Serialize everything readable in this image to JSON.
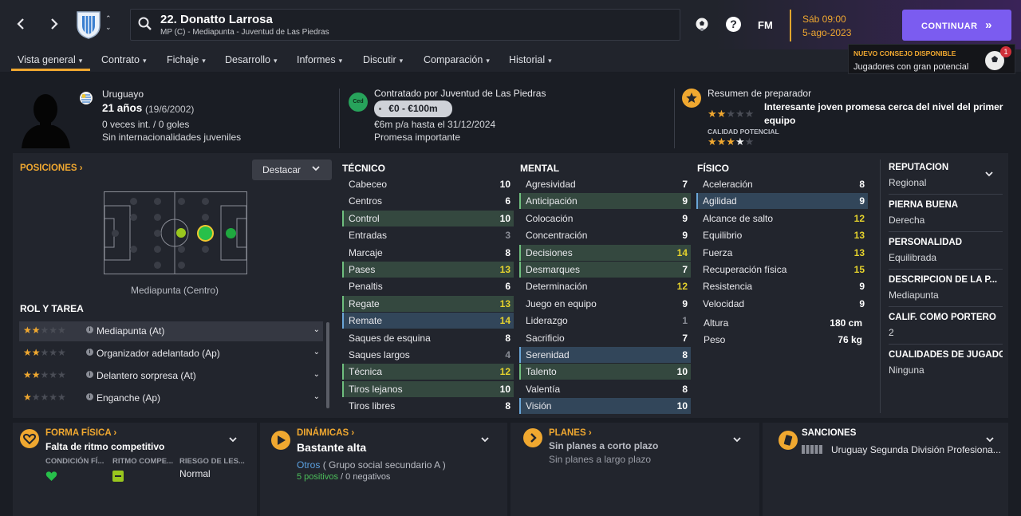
{
  "header": {
    "back_icon": "chevron-left-icon",
    "forward_icon": "chevron-right-icon",
    "player_title": "22. Donatto Larrosa",
    "player_subtitle": "MP (C) - Mediapunta - Juventud de Las Piedras",
    "date_day": "Sáb 09:00",
    "date_full": "5-ago-2023",
    "fm_label": "FM",
    "help_label": "?",
    "continue_label": "CONTINUAR",
    "continue_arrows": "»"
  },
  "advice": {
    "title": "NUEVO CONSEJO DISPONIBLE",
    "text": "Jugadores con gran potencial",
    "count": "1"
  },
  "tabs": [
    {
      "label": "Vista general"
    },
    {
      "label": "Contrato"
    },
    {
      "label": "Fichaje"
    },
    {
      "label": "Desarrollo"
    },
    {
      "label": "Informes"
    },
    {
      "label": "Discutir"
    },
    {
      "label": "Comparación"
    },
    {
      "label": "Historial"
    }
  ],
  "profile": {
    "nationality": "Uruguayo",
    "age": "21 años",
    "birth": "(19/6/2002)",
    "caps": "0 veces int. / 0 goles",
    "youth": "Sin internacionalidades juveniles"
  },
  "contract": {
    "badge": "Ced",
    "contracted_by": "Contratado por Juventud de Las Piedras",
    "value": "€0 - €100m",
    "wage": "€6m p/a hasta el 31/12/2024",
    "status": "Promesa importante"
  },
  "coach": {
    "title": "Resumen de preparador",
    "summary": "Interesante joven promesa cerca del nivel del primer equipo",
    "current_ability_stars": 2,
    "potential_label": "CALIDAD POTENCIAL",
    "potential_stars": 3.5
  },
  "positions": {
    "title": "POSICIONES",
    "dropdown": "Destacar",
    "position_name": "Mediapunta (Centro)"
  },
  "roles": {
    "title": "ROL Y TAREA",
    "items": [
      {
        "name": "Mediapunta (At)",
        "stars": 2
      },
      {
        "name": "Organizador adelantado (Ap)",
        "stars": 2
      },
      {
        "name": "Delantero sorpresa (At)",
        "stars": 2
      },
      {
        "name": "Enganche (Ap)",
        "stars": 1
      }
    ]
  },
  "technical": {
    "title": "TÉCNICO",
    "rows": [
      {
        "name": "Cabeceo",
        "value": "10",
        "hl": "",
        "tone": ""
      },
      {
        "name": "Centros",
        "value": "6",
        "hl": "",
        "tone": ""
      },
      {
        "name": "Control",
        "value": "10",
        "hl": "green",
        "tone": ""
      },
      {
        "name": "Entradas",
        "value": "3",
        "hl": "",
        "tone": "dim"
      },
      {
        "name": "Marcaje",
        "value": "8",
        "hl": "",
        "tone": ""
      },
      {
        "name": "Pases",
        "value": "13",
        "hl": "green",
        "tone": "y"
      },
      {
        "name": "Penaltis",
        "value": "6",
        "hl": "",
        "tone": ""
      },
      {
        "name": "Regate",
        "value": "13",
        "hl": "green",
        "tone": "y"
      },
      {
        "name": "Remate",
        "value": "14",
        "hl": "blue",
        "tone": "y"
      },
      {
        "name": "Saques de esquina",
        "value": "8",
        "hl": "",
        "tone": ""
      },
      {
        "name": "Saques largos",
        "value": "4",
        "hl": "",
        "tone": "dim"
      },
      {
        "name": "Técnica",
        "value": "12",
        "hl": "green",
        "tone": "y"
      },
      {
        "name": "Tiros lejanos",
        "value": "10",
        "hl": "green",
        "tone": ""
      },
      {
        "name": "Tiros libres",
        "value": "8",
        "hl": "",
        "tone": ""
      }
    ]
  },
  "mental": {
    "title": "MENTAL",
    "rows": [
      {
        "name": "Agresividad",
        "value": "7",
        "hl": "",
        "tone": ""
      },
      {
        "name": "Anticipación",
        "value": "9",
        "hl": "green",
        "tone": ""
      },
      {
        "name": "Colocación",
        "value": "9",
        "hl": "",
        "tone": ""
      },
      {
        "name": "Concentración",
        "value": "9",
        "hl": "",
        "tone": ""
      },
      {
        "name": "Decisiones",
        "value": "14",
        "hl": "green",
        "tone": "y"
      },
      {
        "name": "Desmarques",
        "value": "7",
        "hl": "green",
        "tone": ""
      },
      {
        "name": "Determinación",
        "value": "12",
        "hl": "",
        "tone": "y"
      },
      {
        "name": "Juego en equipo",
        "value": "9",
        "hl": "",
        "tone": ""
      },
      {
        "name": "Liderazgo",
        "value": "1",
        "hl": "",
        "tone": "dim"
      },
      {
        "name": "Sacrificio",
        "value": "7",
        "hl": "",
        "tone": ""
      },
      {
        "name": "Serenidad",
        "value": "8",
        "hl": "blue",
        "tone": ""
      },
      {
        "name": "Talento",
        "value": "10",
        "hl": "green",
        "tone": ""
      },
      {
        "name": "Valentía",
        "value": "8",
        "hl": "",
        "tone": ""
      },
      {
        "name": "Visión",
        "value": "10",
        "hl": "blue",
        "tone": ""
      }
    ]
  },
  "physical": {
    "title": "FÍSICO",
    "rows": [
      {
        "name": "Aceleración",
        "value": "8",
        "hl": "",
        "tone": ""
      },
      {
        "name": "Agilidad",
        "value": "9",
        "hl": "blue",
        "tone": ""
      },
      {
        "name": "Alcance de salto",
        "value": "12",
        "hl": "",
        "tone": "y"
      },
      {
        "name": "Equilibrio",
        "value": "13",
        "hl": "",
        "tone": "y"
      },
      {
        "name": "Fuerza",
        "value": "13",
        "hl": "",
        "tone": "y"
      },
      {
        "name": "Recuperación física",
        "value": "15",
        "hl": "",
        "tone": "y"
      },
      {
        "name": "Resistencia",
        "value": "9",
        "hl": "",
        "tone": ""
      },
      {
        "name": "Velocidad",
        "value": "9",
        "hl": "",
        "tone": ""
      }
    ],
    "height_label": "Altura",
    "height_value": "180 cm",
    "weight_label": "Peso",
    "weight_value": "76 kg"
  },
  "side": {
    "items": [
      {
        "heading": "REPUTACIÓN",
        "value": "Regional"
      },
      {
        "heading": "PIERNA BUENA",
        "value": "Derecha"
      },
      {
        "heading": "PERSONALIDAD",
        "value": "Equilibrada"
      },
      {
        "heading": "DESCRIPCIÓN DE LA P...",
        "value": "Mediapunta"
      },
      {
        "heading": "CALIF. COMO PORTERO",
        "value": "2"
      },
      {
        "heading": "CUALIDADES DE JUGADO",
        "value": "Ninguna"
      }
    ]
  },
  "fitness": {
    "title": "FORMA FÍSICA",
    "status": "Falta de ritmo competitivo",
    "col1": "CONDICIÓN FÍ...",
    "col2": "RITMO COMPE...",
    "col3": "RIESGO DE LES...",
    "risk": "Normal"
  },
  "dynamics": {
    "title": "DINÁMICAS",
    "value": "Bastante alta",
    "group_link": "Otros",
    "group_text": "( Grupo social secundario A )",
    "positives": "5 positivos",
    "slash": "/",
    "negatives": "0 negativos"
  },
  "plans": {
    "title": "PLANES",
    "short": "Sin planes a corto plazo",
    "long": "Sin planes a largo plazo"
  },
  "sanctions": {
    "title": "SANCIONES",
    "league": "Uruguay Segunda División Profesiona..."
  }
}
